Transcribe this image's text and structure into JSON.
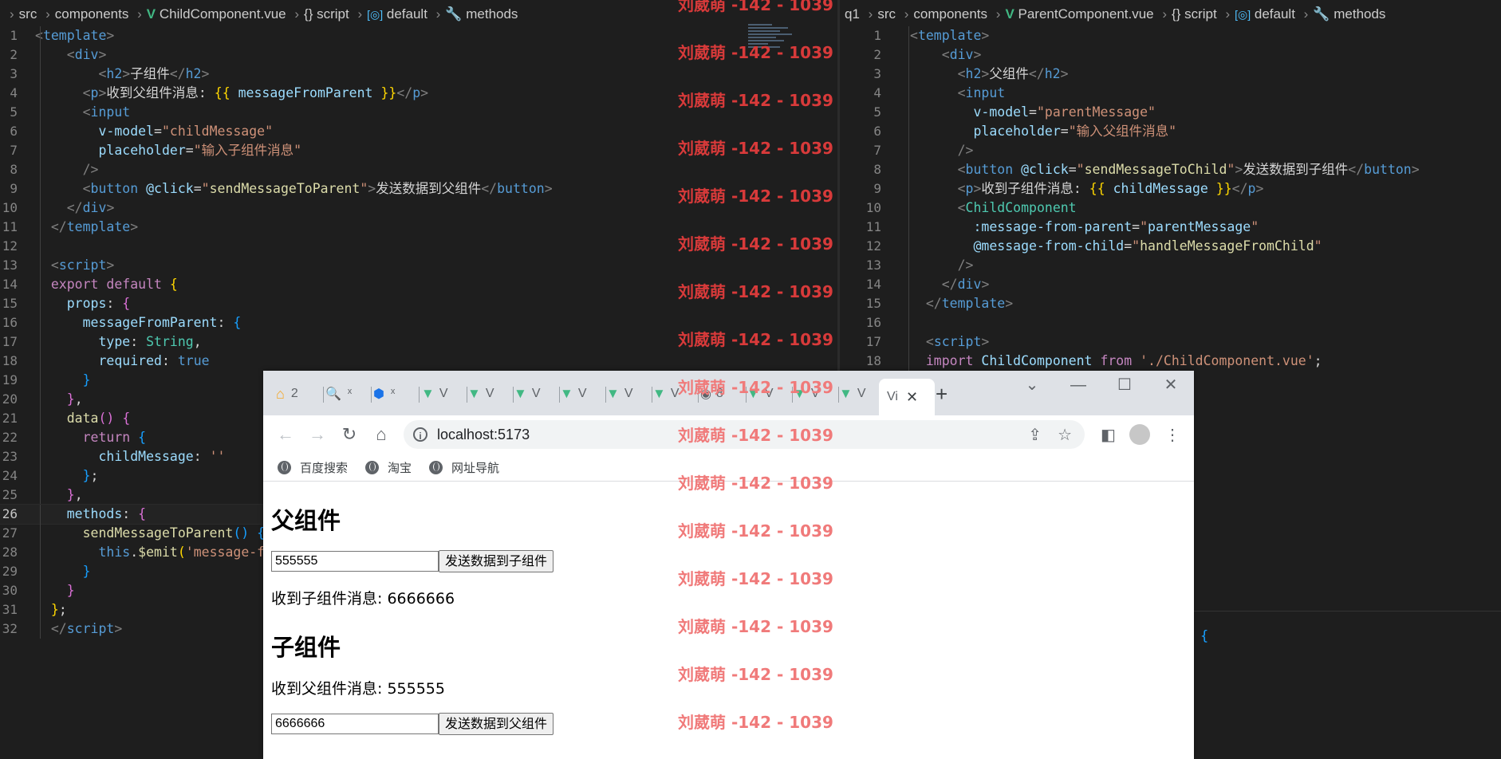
{
  "left_editor": {
    "breadcrumb": [
      "src",
      "components",
      "ChildComponent.vue",
      "{} script",
      "default",
      "methods"
    ],
    "lines": [
      {
        "n": "1",
        "html": "<span class='tk-tag'>&lt;</span><span class='tk-name'>template</span><span class='tk-tag'>&gt;</span>"
      },
      {
        "n": "2",
        "html": "    <span class='tk-tag'>&lt;</span><span class='tk-name'>div</span><span class='tk-tag'>&gt;</span>"
      },
      {
        "n": "3",
        "html": "        <span class='tk-tag'>&lt;</span><span class='tk-name'>h2</span><span class='tk-tag'>&gt;</span>子组件<span class='tk-tag'>&lt;/</span><span class='tk-name'>h2</span><span class='tk-tag'>&gt;</span>"
      },
      {
        "n": "4",
        "html": "      <span class='tk-tag'>&lt;</span><span class='tk-name'>p</span><span class='tk-tag'>&gt;</span>收到父组件消息: <span class='tk-brace'>{{</span> <span class='tk-var'>messageFromParent</span> <span class='tk-brace'>}}</span><span class='tk-tag'>&lt;/</span><span class='tk-name'>p</span><span class='tk-tag'>&gt;</span>"
      },
      {
        "n": "5",
        "html": "      <span class='tk-tag'>&lt;</span><span class='tk-name'>input</span>"
      },
      {
        "n": "6",
        "html": "        <span class='tk-attr'>v-model</span>=<span class='tk-str'>\"childMessage\"</span>"
      },
      {
        "n": "7",
        "html": "        <span class='tk-attr'>placeholder</span>=<span class='tk-str'>\"输入子组件消息\"</span>"
      },
      {
        "n": "8",
        "html": "      <span class='tk-tag'>/&gt;</span>"
      },
      {
        "n": "9",
        "html": "      <span class='tk-tag'>&lt;</span><span class='tk-name'>button</span> <span class='tk-attr'>@click</span>=<span class='tk-str'>\"</span><span class='tk-fn'>sendMessageToParent</span><span class='tk-str'>\"</span><span class='tk-tag'>&gt;</span>发送数据到父组件<span class='tk-tag'>&lt;/</span><span class='tk-name'>button</span><span class='tk-tag'>&gt;</span>"
      },
      {
        "n": "10",
        "html": "    <span class='tk-tag'>&lt;/</span><span class='tk-name'>div</span><span class='tk-tag'>&gt;</span>"
      },
      {
        "n": "11",
        "html": "  <span class='tk-tag'>&lt;/</span><span class='tk-name'>template</span><span class='tk-tag'>&gt;</span>"
      },
      {
        "n": "12",
        "html": ""
      },
      {
        "n": "13",
        "html": "  <span class='tk-tag'>&lt;</span><span class='tk-name'>script</span><span class='tk-tag'>&gt;</span>"
      },
      {
        "n": "14",
        "html": "  <span class='tk-kw'>export</span> <span class='tk-kw'>default</span> <span class='tk-brace'>{</span>"
      },
      {
        "n": "15",
        "html": "    <span class='tk-var'>props</span>: <span class='tk-brace2'>{</span>"
      },
      {
        "n": "16",
        "html": "      <span class='tk-var'>messageFromParent</span>: <span class='tk-brace3'>{</span>"
      },
      {
        "n": "17",
        "html": "        <span class='tk-var'>type</span>: <span class='tk-type'>String</span>,"
      },
      {
        "n": "18",
        "html": "        <span class='tk-var'>required</span>: <span class='tk-bool'>true</span>"
      },
      {
        "n": "19",
        "html": "      <span class='tk-brace3'>}</span>"
      },
      {
        "n": "20",
        "html": "    <span class='tk-brace2'>}</span>,"
      },
      {
        "n": "21",
        "html": "    <span class='tk-fn'>data</span><span class='tk-brace2'>()</span> <span class='tk-brace2'>{</span>"
      },
      {
        "n": "22",
        "html": "      <span class='tk-kw'>return</span> <span class='tk-brace3'>{</span>"
      },
      {
        "n": "23",
        "html": "        <span class='tk-var'>childMessage</span>: <span class='tk-str'>''</span>"
      },
      {
        "n": "24",
        "html": "      <span class='tk-brace3'>}</span>;"
      },
      {
        "n": "25",
        "html": "    <span class='tk-brace2'>}</span>,"
      },
      {
        "n": "26",
        "html": "    <span class='tk-var'>methods</span>: <span class='tk-brace2'>{</span>",
        "active": true
      },
      {
        "n": "27",
        "html": "      <span class='tk-fn'>sendMessageToParent</span><span class='tk-brace3'>()</span> <span class='tk-brace3'>{</span>"
      },
      {
        "n": "28",
        "html": "        <span class='tk-name'>this</span>.<span class='tk-fn'>$emit</span><span class='tk-brace'>(</span><span class='tk-str'>'message-f</span>"
      },
      {
        "n": "29",
        "html": "      <span class='tk-brace3'>}</span>"
      },
      {
        "n": "30",
        "html": "    <span class='tk-brace2'>}</span>"
      },
      {
        "n": "31",
        "html": "  <span class='tk-brace'>}</span>;"
      },
      {
        "n": "32",
        "html": "  <span class='tk-tag'>&lt;/</span><span class='tk-name'>script</span><span class='tk-tag'>&gt;</span>"
      }
    ]
  },
  "right_editor": {
    "breadcrumb": [
      "q1",
      "src",
      "components",
      "ParentComponent.vue",
      "{} script",
      "default",
      "methods"
    ],
    "lines": [
      {
        "n": "1",
        "html": "<span class='tk-tag'>&lt;</span><span class='tk-name'>template</span><span class='tk-tag'>&gt;</span>"
      },
      {
        "n": "2",
        "html": "    <span class='tk-tag'>&lt;</span><span class='tk-name'>div</span><span class='tk-tag'>&gt;</span>"
      },
      {
        "n": "3",
        "html": "      <span class='tk-tag'>&lt;</span><span class='tk-name'>h2</span><span class='tk-tag'>&gt;</span>父组件<span class='tk-tag'>&lt;/</span><span class='tk-name'>h2</span><span class='tk-tag'>&gt;</span>"
      },
      {
        "n": "4",
        "html": "      <span class='tk-tag'>&lt;</span><span class='tk-name'>input</span>"
      },
      {
        "n": "5",
        "html": "        <span class='tk-attr'>v-model</span>=<span class='tk-str'>\"parentMessage\"</span>"
      },
      {
        "n": "6",
        "html": "        <span class='tk-attr'>placeholder</span>=<span class='tk-str'>\"输入父组件消息\"</span>"
      },
      {
        "n": "7",
        "html": "      <span class='tk-tag'>/&gt;</span>"
      },
      {
        "n": "8",
        "html": "      <span class='tk-tag'>&lt;</span><span class='tk-name'>button</span> <span class='tk-attr'>@click</span>=<span class='tk-str'>\"</span><span class='tk-fn'>sendMessageToChild</span><span class='tk-str'>\"</span><span class='tk-tag'>&gt;</span>发送数据到子组件<span class='tk-tag'>&lt;/</span><span class='tk-name'>button</span><span class='tk-tag'>&gt;</span>"
      },
      {
        "n": "9",
        "html": "      <span class='tk-tag'>&lt;</span><span class='tk-name'>p</span><span class='tk-tag'>&gt;</span>收到子组件消息: <span class='tk-brace'>{{</span> <span class='tk-var'>childMessage</span> <span class='tk-brace'>}}</span><span class='tk-tag'>&lt;/</span><span class='tk-name'>p</span><span class='tk-tag'>&gt;</span>"
      },
      {
        "n": "10",
        "html": "      <span class='tk-tag'>&lt;</span><span class='tk-comp'>ChildComponent</span>"
      },
      {
        "n": "11",
        "html": "        <span class='tk-attr'>:message-from-parent</span>=<span class='tk-str'>\"</span><span class='tk-var'>parentMessage</span><span class='tk-str'>\"</span>"
      },
      {
        "n": "12",
        "html": "        <span class='tk-attr'>@message-from-child</span>=<span class='tk-str'>\"</span><span class='tk-fn'>handleMessageFromChild</span><span class='tk-str'>\"</span>"
      },
      {
        "n": "13",
        "html": "      <span class='tk-tag'>/&gt;</span>"
      },
      {
        "n": "14",
        "html": "    <span class='tk-tag'>&lt;/</span><span class='tk-name'>div</span><span class='tk-tag'>&gt;</span>"
      },
      {
        "n": "15",
        "html": "  <span class='tk-tag'>&lt;/</span><span class='tk-name'>template</span><span class='tk-tag'>&gt;</span>"
      },
      {
        "n": "16",
        "html": ""
      },
      {
        "n": "17",
        "html": "  <span class='tk-tag'>&lt;</span><span class='tk-name'>script</span><span class='tk-tag'>&gt;</span>"
      },
      {
        "n": "18",
        "html": "  <span class='tk-kw'>import</span> <span class='tk-var'>ChildComponent</span> <span class='tk-kw'>from</span> <span class='tk-str'>'./ChildComponent.vue'</span>;"
      }
    ],
    "stray_brace": "{"
  },
  "watermark": "刘葳萌 -142 - 1039",
  "browser": {
    "tabs": [
      "2",
      "ˣ",
      "ˣ",
      "V",
      "V",
      "V",
      "V",
      "V",
      "V",
      "8",
      "V",
      "V",
      "V",
      "Vi"
    ],
    "new_tab": "+",
    "url": "localhost:5173",
    "bookmarks": [
      "百度搜索",
      "淘宝",
      "网址导航"
    ],
    "page": {
      "parent_heading": "父组件",
      "parent_input_value": "555555",
      "parent_button": "发送数据到子组件",
      "parent_received": "收到子组件消息: 6666666",
      "child_heading": "子组件",
      "child_received": "收到父组件消息: 555555",
      "child_input_value": "6666666",
      "child_button": "发送数据到父组件"
    }
  },
  "colors": {
    "vue_green": "#41b883",
    "watermark_red": "#d83a3a",
    "editor_bg": "#1e1e1e"
  }
}
